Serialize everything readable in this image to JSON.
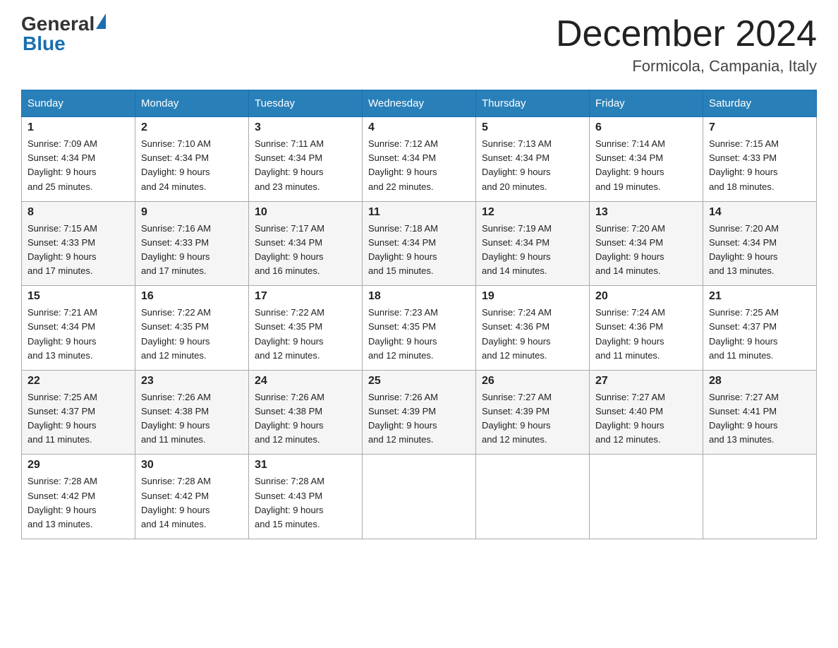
{
  "header": {
    "logo_general": "General",
    "logo_blue": "Blue",
    "month_title": "December 2024",
    "location": "Formicola, Campania, Italy"
  },
  "days_of_week": [
    "Sunday",
    "Monday",
    "Tuesday",
    "Wednesday",
    "Thursday",
    "Friday",
    "Saturday"
  ],
  "weeks": [
    [
      {
        "day": "1",
        "sunrise": "7:09 AM",
        "sunset": "4:34 PM",
        "daylight": "9 hours and 25 minutes."
      },
      {
        "day": "2",
        "sunrise": "7:10 AM",
        "sunset": "4:34 PM",
        "daylight": "9 hours and 24 minutes."
      },
      {
        "day": "3",
        "sunrise": "7:11 AM",
        "sunset": "4:34 PM",
        "daylight": "9 hours and 23 minutes."
      },
      {
        "day": "4",
        "sunrise": "7:12 AM",
        "sunset": "4:34 PM",
        "daylight": "9 hours and 22 minutes."
      },
      {
        "day": "5",
        "sunrise": "7:13 AM",
        "sunset": "4:34 PM",
        "daylight": "9 hours and 20 minutes."
      },
      {
        "day": "6",
        "sunrise": "7:14 AM",
        "sunset": "4:34 PM",
        "daylight": "9 hours and 19 minutes."
      },
      {
        "day": "7",
        "sunrise": "7:15 AM",
        "sunset": "4:33 PM",
        "daylight": "9 hours and 18 minutes."
      }
    ],
    [
      {
        "day": "8",
        "sunrise": "7:15 AM",
        "sunset": "4:33 PM",
        "daylight": "9 hours and 17 minutes."
      },
      {
        "day": "9",
        "sunrise": "7:16 AM",
        "sunset": "4:33 PM",
        "daylight": "9 hours and 17 minutes."
      },
      {
        "day": "10",
        "sunrise": "7:17 AM",
        "sunset": "4:34 PM",
        "daylight": "9 hours and 16 minutes."
      },
      {
        "day": "11",
        "sunrise": "7:18 AM",
        "sunset": "4:34 PM",
        "daylight": "9 hours and 15 minutes."
      },
      {
        "day": "12",
        "sunrise": "7:19 AM",
        "sunset": "4:34 PM",
        "daylight": "9 hours and 14 minutes."
      },
      {
        "day": "13",
        "sunrise": "7:20 AM",
        "sunset": "4:34 PM",
        "daylight": "9 hours and 14 minutes."
      },
      {
        "day": "14",
        "sunrise": "7:20 AM",
        "sunset": "4:34 PM",
        "daylight": "9 hours and 13 minutes."
      }
    ],
    [
      {
        "day": "15",
        "sunrise": "7:21 AM",
        "sunset": "4:34 PM",
        "daylight": "9 hours and 13 minutes."
      },
      {
        "day": "16",
        "sunrise": "7:22 AM",
        "sunset": "4:35 PM",
        "daylight": "9 hours and 12 minutes."
      },
      {
        "day": "17",
        "sunrise": "7:22 AM",
        "sunset": "4:35 PM",
        "daylight": "9 hours and 12 minutes."
      },
      {
        "day": "18",
        "sunrise": "7:23 AM",
        "sunset": "4:35 PM",
        "daylight": "9 hours and 12 minutes."
      },
      {
        "day": "19",
        "sunrise": "7:24 AM",
        "sunset": "4:36 PM",
        "daylight": "9 hours and 12 minutes."
      },
      {
        "day": "20",
        "sunrise": "7:24 AM",
        "sunset": "4:36 PM",
        "daylight": "9 hours and 11 minutes."
      },
      {
        "day": "21",
        "sunrise": "7:25 AM",
        "sunset": "4:37 PM",
        "daylight": "9 hours and 11 minutes."
      }
    ],
    [
      {
        "day": "22",
        "sunrise": "7:25 AM",
        "sunset": "4:37 PM",
        "daylight": "9 hours and 11 minutes."
      },
      {
        "day": "23",
        "sunrise": "7:26 AM",
        "sunset": "4:38 PM",
        "daylight": "9 hours and 11 minutes."
      },
      {
        "day": "24",
        "sunrise": "7:26 AM",
        "sunset": "4:38 PM",
        "daylight": "9 hours and 12 minutes."
      },
      {
        "day": "25",
        "sunrise": "7:26 AM",
        "sunset": "4:39 PM",
        "daylight": "9 hours and 12 minutes."
      },
      {
        "day": "26",
        "sunrise": "7:27 AM",
        "sunset": "4:39 PM",
        "daylight": "9 hours and 12 minutes."
      },
      {
        "day": "27",
        "sunrise": "7:27 AM",
        "sunset": "4:40 PM",
        "daylight": "9 hours and 12 minutes."
      },
      {
        "day": "28",
        "sunrise": "7:27 AM",
        "sunset": "4:41 PM",
        "daylight": "9 hours and 13 minutes."
      }
    ],
    [
      {
        "day": "29",
        "sunrise": "7:28 AM",
        "sunset": "4:42 PM",
        "daylight": "9 hours and 13 minutes."
      },
      {
        "day": "30",
        "sunrise": "7:28 AM",
        "sunset": "4:42 PM",
        "daylight": "9 hours and 14 minutes."
      },
      {
        "day": "31",
        "sunrise": "7:28 AM",
        "sunset": "4:43 PM",
        "daylight": "9 hours and 15 minutes."
      },
      null,
      null,
      null,
      null
    ]
  ],
  "labels": {
    "sunrise": "Sunrise:",
    "sunset": "Sunset:",
    "daylight": "Daylight:"
  }
}
